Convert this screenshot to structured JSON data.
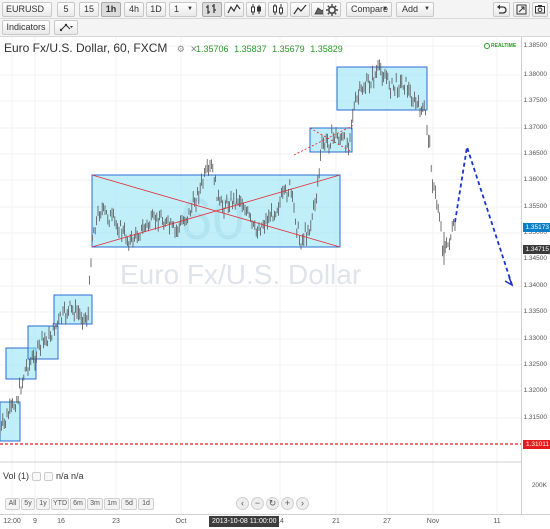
{
  "toolbar": {
    "symbol": "EURUSD",
    "intervals": [
      "5",
      "15",
      "1h",
      "4h",
      "1D",
      "1"
    ],
    "active_interval": "1h",
    "compare_label": "Compare",
    "add_label": "Add"
  },
  "toolbar2": {
    "indicators_label": "Indicators"
  },
  "chart": {
    "title": "Euro Fx/U.S. Dollar, 60, FXCM",
    "ohlc": [
      "1.35706",
      "1.35837",
      "1.35679",
      "1.35829"
    ],
    "realtime_label": "REALTIME",
    "watermark_big": "60",
    "watermark_small": "Euro Fx/U.S. Dollar"
  },
  "price_axis": {
    "labels": [
      "1.38500",
      "1.38000",
      "1.37500",
      "1.37000",
      "1.36500",
      "1.36000",
      "1.35500",
      "1.35000",
      "1.34500",
      "1.34000",
      "1.33500",
      "1.33000",
      "1.32500",
      "1.32000",
      "1.31500"
    ],
    "current_price": "1.35173",
    "marker_price": "1.34715",
    "support_price": "1.31011",
    "colors": {
      "current": "#0b7ec8",
      "marker": "#3b3b3b",
      "support": "#e51c1c"
    }
  },
  "volume": {
    "label": "Vol (1)",
    "value": "n/a n/a",
    "axis_label": "200K"
  },
  "bottom_bar": {
    "ranges": [
      "All",
      "5y",
      "1y",
      "YTD",
      "6m",
      "3m",
      "1m",
      "5d",
      "1d"
    ]
  },
  "time_axis": {
    "labels": [
      "12:00",
      "9",
      "16",
      "23",
      "Oct",
      "14",
      "21",
      "27",
      "Nov",
      "11"
    ],
    "cursor_label": "2013-10-08 11:00:00"
  }
}
